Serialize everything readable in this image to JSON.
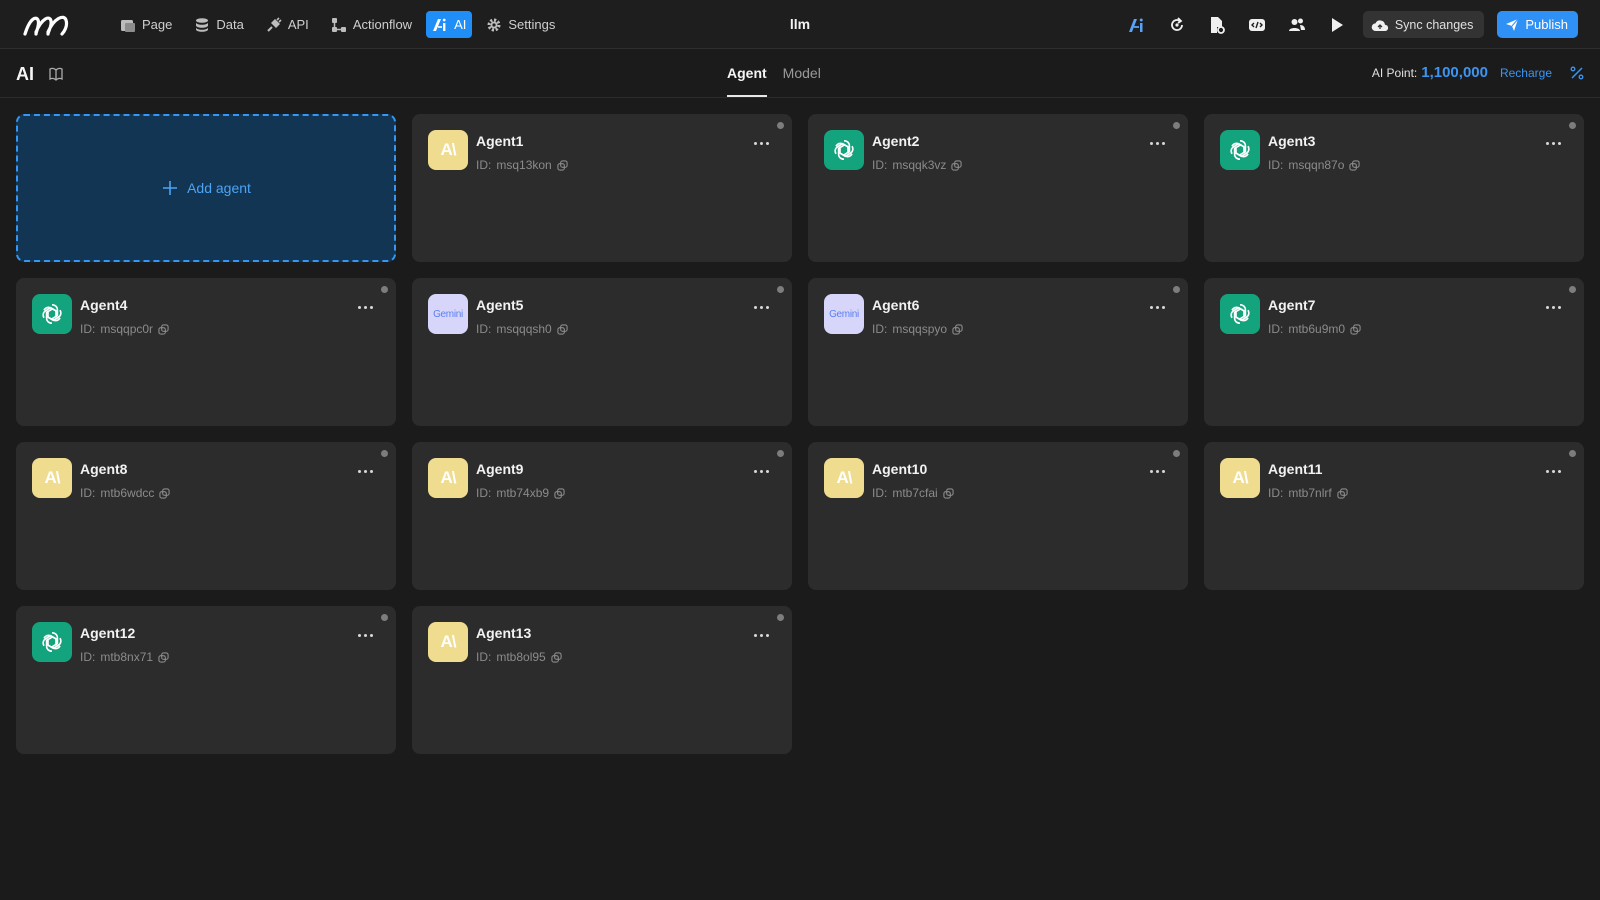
{
  "topbar": {
    "nav": [
      {
        "label": "Page",
        "icon": "page-icon"
      },
      {
        "label": "Data",
        "icon": "database-icon"
      },
      {
        "label": "API",
        "icon": "api-plug-icon"
      },
      {
        "label": "Actionflow",
        "icon": "actionflow-icon"
      },
      {
        "label": "AI",
        "icon": "ai-icon",
        "active": true
      },
      {
        "label": "Settings",
        "icon": "gear-icon"
      }
    ],
    "project_name": "llm",
    "sync_label": "Sync changes",
    "publish_label": "Publish"
  },
  "subbar": {
    "title": "AI",
    "tabs": [
      {
        "label": "Agent",
        "active": true
      },
      {
        "label": "Model",
        "active": false
      }
    ],
    "points_label": "AI Point:",
    "points_value": "1,100,000",
    "recharge_label": "Recharge"
  },
  "add_agent_label": "Add agent",
  "colors": {
    "accent": "#1f8ff7",
    "anthropic": "#f0dc8e",
    "openai": "#13a37d",
    "gemini": "#d7d6fa"
  },
  "agents": [
    {
      "name": "Agent1",
      "id_prefix": "ID:",
      "id": "msq13kon",
      "provider": "anthropic",
      "avatar_text": "A\\"
    },
    {
      "name": "Agent2",
      "id_prefix": "ID:",
      "id": "msqqk3vz",
      "provider": "openai",
      "avatar_text": ""
    },
    {
      "name": "Agent3",
      "id_prefix": "ID:",
      "id": "msqqn87o",
      "provider": "openai",
      "avatar_text": ""
    },
    {
      "name": "Agent4",
      "id_prefix": "ID:",
      "id": "msqqpc0r",
      "provider": "openai",
      "avatar_text": ""
    },
    {
      "name": "Agent5",
      "id_prefix": "ID:",
      "id": "msqqqsh0",
      "provider": "gemini",
      "avatar_text": "Gemini"
    },
    {
      "name": "Agent6",
      "id_prefix": "ID:",
      "id": "msqqspyo",
      "provider": "gemini",
      "avatar_text": "Gemini"
    },
    {
      "name": "Agent7",
      "id_prefix": "ID:",
      "id": "mtb6u9m0",
      "provider": "openai",
      "avatar_text": ""
    },
    {
      "name": "Agent8",
      "id_prefix": "ID:",
      "id": "mtb6wdcc",
      "provider": "anthropic",
      "avatar_text": "A\\"
    },
    {
      "name": "Agent9",
      "id_prefix": "ID:",
      "id": "mtb74xb9",
      "provider": "anthropic",
      "avatar_text": "A\\"
    },
    {
      "name": "Agent10",
      "id_prefix": "ID:",
      "id": "mtb7cfai",
      "provider": "anthropic",
      "avatar_text": "A\\"
    },
    {
      "name": "Agent11",
      "id_prefix": "ID:",
      "id": "mtb7nlrf",
      "provider": "anthropic",
      "avatar_text": "A\\"
    },
    {
      "name": "Agent12",
      "id_prefix": "ID:",
      "id": "mtb8nx71",
      "provider": "openai",
      "avatar_text": ""
    },
    {
      "name": "Agent13",
      "id_prefix": "ID:",
      "id": "mtb8ol95",
      "provider": "anthropic",
      "avatar_text": "A\\"
    }
  ]
}
